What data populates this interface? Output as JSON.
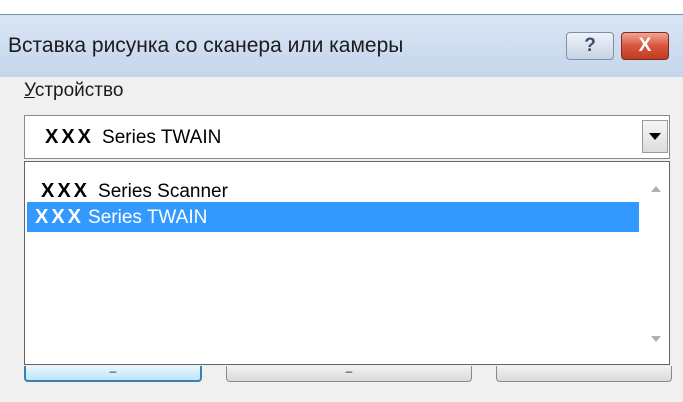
{
  "dialog": {
    "title": "Вставка рисунка со сканера или камеры",
    "help_label": "?",
    "close_label": "X"
  },
  "device": {
    "label_access_key": "У",
    "label_rest": "стройство",
    "selected": {
      "brand": "XXX",
      "name": "Series TWAIN"
    },
    "options": [
      {
        "brand": "XXX",
        "name": "Series Scanner",
        "highlighted": false
      },
      {
        "brand": "XXX",
        "name": "Series TWAIN",
        "highlighted": true
      }
    ]
  },
  "buttons": {
    "first_partial": "–",
    "second_partial": "–"
  },
  "colors": {
    "highlight": "#3399ff",
    "close_button": "#c23b22",
    "titlebar": "#cddcef"
  }
}
